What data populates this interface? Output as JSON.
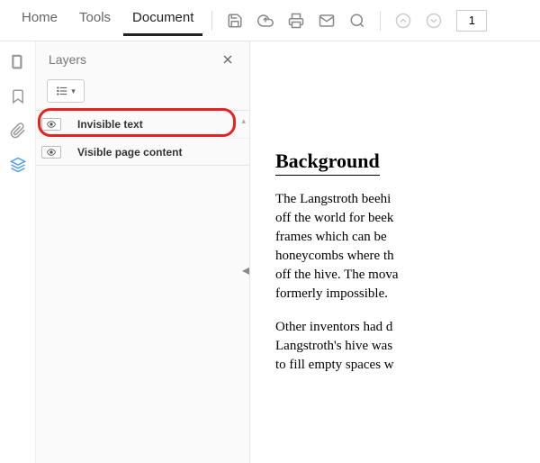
{
  "toolbar": {
    "tabs": {
      "home": "Home",
      "tools": "Tools",
      "document": "Document"
    },
    "page_number": "1"
  },
  "rail": {
    "items": [
      "thumbnails",
      "bookmarks",
      "attachments",
      "layers"
    ]
  },
  "layers_panel": {
    "title": "Layers",
    "items": [
      {
        "label": "Invisible text"
      },
      {
        "label": "Visible page content"
      }
    ],
    "highlight_index": 0
  },
  "document": {
    "heading": "Background",
    "paragraphs": [
      "The Langstroth beehi\noff the world for beek\nframes which can be\nhoneycombs where th\noff the hive. The mova\nformerly impossible.",
      "Other inventors had d\nLangstroth's hive was\nto fill empty spaces w"
    ]
  }
}
